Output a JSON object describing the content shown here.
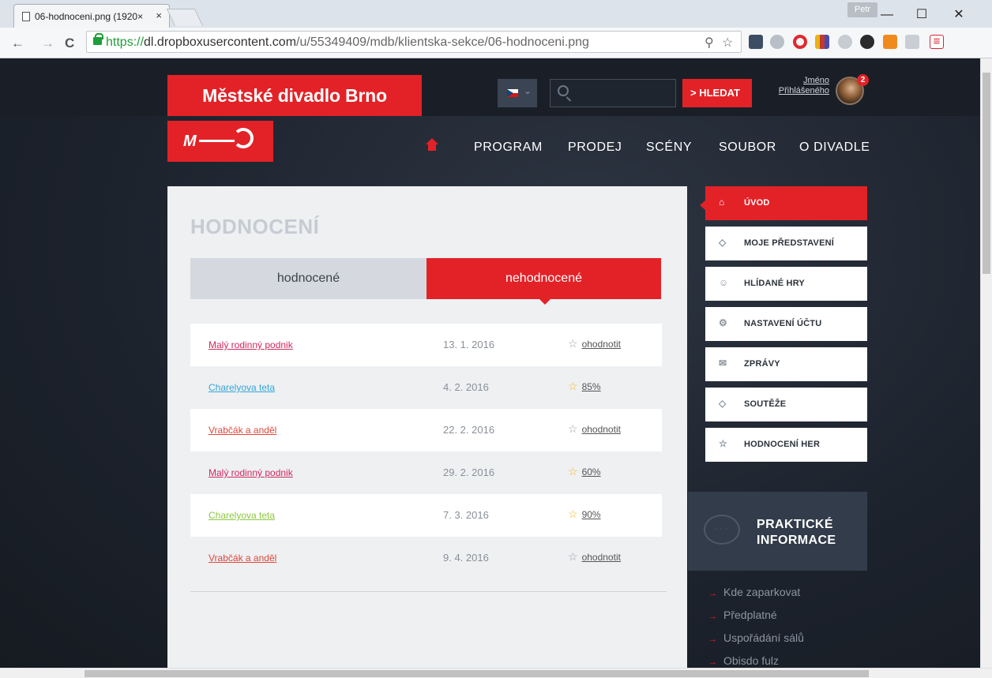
{
  "browser": {
    "tab_title": "06-hodnoceni.png (1920×",
    "tab_close": "×",
    "profile": "Petr",
    "url_scheme": "https://",
    "url_host": "dl.dropboxusercontent.com",
    "url_path": "/u/55349409/mdb/klientska-sekce/06-hodnoceni.png",
    "back": "←",
    "forward": "→",
    "reload": "C",
    "zoom_icon": "⚲",
    "bookmark_star": "☆",
    "minimize": "—",
    "maximize": "☐",
    "close": "✕",
    "menu": "≡"
  },
  "site": {
    "brand": "Městské divadlo Brno",
    "search_button": "HLEDAT",
    "search_arrow": ">",
    "user_name": "Jméno",
    "user_surname": "Přihlášeného",
    "notifications": "2",
    "lang_chevron": "⌄",
    "logo_text": "M"
  },
  "nav": [
    "PROGRAM",
    "PRODEJ",
    "SCÉNY",
    "SOUBOR",
    "O DIVADLE"
  ],
  "main": {
    "heading": "HODNOCENÍ",
    "tab_rated": "hodnocené",
    "tab_unrated": "nehodnocené",
    "rows": [
      {
        "title": "Malý rodinný podnik",
        "date": "13. 1. 2016",
        "rating": "ohodnotit",
        "title_color": "#d2275d",
        "rated": false
      },
      {
        "title": "Charelyova teta",
        "date": "4. 2. 2016",
        "rating": "85%",
        "title_color": "#35a6d8",
        "rated": true
      },
      {
        "title": "Vrabčák a anděl",
        "date": "22. 2. 2016",
        "rating": "ohodnotit",
        "title_color": "#e0463a",
        "rated": false
      },
      {
        "title": "Malý rodinný podnik",
        "date": "29. 2. 2016",
        "rating": "60%",
        "title_color": "#d2275d",
        "rated": true
      },
      {
        "title": "Charelyova teta",
        "date": "7. 3. 2016",
        "rating": "90%",
        "title_color": "#8cc63f",
        "rated": true
      },
      {
        "title": "Vrabčák a anděl",
        "date": "9. 4. 2016",
        "rating": "ohodnotit",
        "title_color": "#e0463a",
        "rated": false
      }
    ]
  },
  "side_menu": [
    {
      "label": "ÚVOD",
      "icon": "home-icon",
      "glyph": "⌂"
    },
    {
      "label": "MOJE PŘEDSTAVENÍ",
      "icon": "ticket-icon",
      "glyph": "◇"
    },
    {
      "label": "HLÍDANÉ HRY",
      "icon": "theater-masks-icon",
      "glyph": "☺"
    },
    {
      "label": "NASTAVENÍ ÚČTU",
      "icon": "gear-icon",
      "glyph": "⚙"
    },
    {
      "label": "ZPRÁVY",
      "icon": "envelope-icon",
      "glyph": "✉"
    },
    {
      "label": "SOUTĚŽE",
      "icon": "tag-icon",
      "glyph": "◇"
    },
    {
      "label": "HODNOCENÍ HER",
      "icon": "star-icon",
      "glyph": "☆"
    }
  ],
  "info": {
    "title_line1": "PRAKTICKÉ",
    "title_line2": "INFORMACE",
    "bubble": "···",
    "links": [
      "Kde zaparkovat",
      "Předplatné",
      "Uspořádání sálů",
      "Obisdo fulz"
    ]
  },
  "colors": {
    "accent": "#e32227",
    "dark": "#1c222c",
    "star": "#f2b824"
  }
}
